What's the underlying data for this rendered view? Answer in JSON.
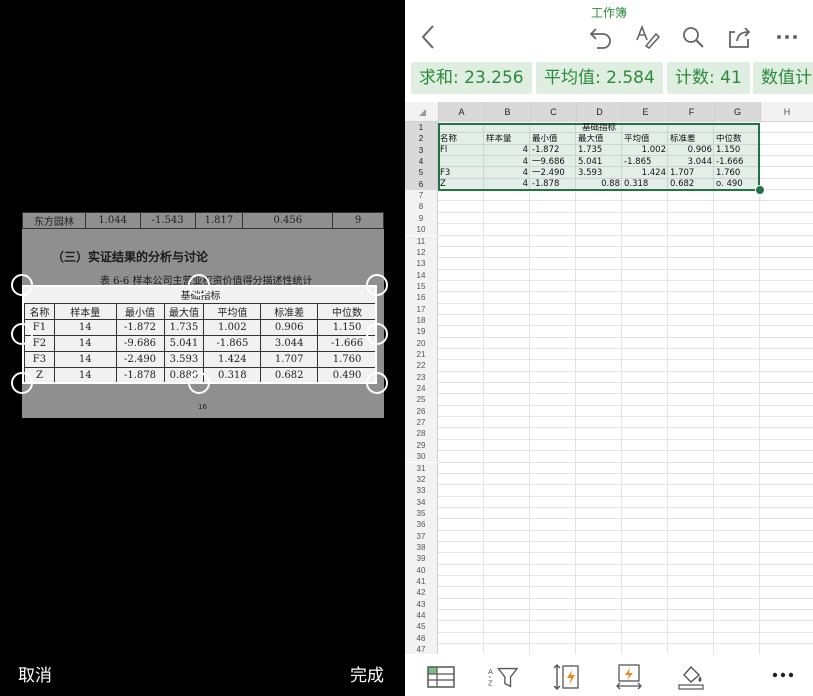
{
  "crop_panel": {
    "cancel_label": "取消",
    "done_label": "完成",
    "photo": {
      "top_rows": [
        [
          "东方园林",
          "1.044",
          "-1.543",
          "1.817",
          "0.456",
          "9"
        ]
      ],
      "heading": "（三）实证结果的分析与讨论",
      "caption": "表 6-6 样本公司主营业权资价值得分描述性统计",
      "table_group_label": "基础指标",
      "table_header": [
        "名称",
        "样本量",
        "最小值",
        "最大值",
        "平均值",
        "标准差",
        "中位数"
      ],
      "table_rows": [
        [
          "F1",
          "14",
          "-1.872",
          "1.735",
          "1.002",
          "0.906",
          "1.150"
        ],
        [
          "F2",
          "14",
          "-9.686",
          "5.041",
          "-1.865",
          "3.044",
          "-1.666"
        ],
        [
          "F3",
          "14",
          "-2.490",
          "3.593",
          "1.424",
          "1.707",
          "1.760"
        ],
        [
          "Z",
          "14",
          "-1.878",
          "0.880",
          "0.318",
          "0.682",
          "0.490"
        ]
      ],
      "page_number": "16"
    }
  },
  "excel": {
    "workbook_title": "工作簿",
    "toolbar_icons": [
      "back-icon",
      "undo-icon",
      "format-text-icon",
      "search-icon",
      "share-icon",
      "more-icon"
    ],
    "stats": {
      "sum": "求和: 23.256",
      "average": "平均值: 2.584",
      "count": "计数: 41",
      "numeric_count": "数值计"
    },
    "columns": [
      "A",
      "B",
      "C",
      "D",
      "E",
      "F",
      "G",
      "H"
    ],
    "rows": [
      "1",
      "2",
      "3",
      "4",
      "5",
      "6",
      "7",
      "8",
      "9",
      "10",
      "11",
      "12",
      "13",
      "14",
      "15",
      "16",
      "17",
      "18",
      "19",
      "20",
      "21",
      "22",
      "23",
      "24",
      "25",
      "26",
      "27",
      "28",
      "29",
      "30",
      "31",
      "32",
      "33",
      "34",
      "35",
      "36",
      "37",
      "38",
      "39",
      "40",
      "41",
      "42",
      "43",
      "44",
      "45",
      "46",
      "47"
    ],
    "cells": {
      "d1": "基础指标",
      "header": [
        "名称",
        "样本量",
        "最小值",
        "最大值",
        "平均值",
        "标准差",
        "中位数"
      ],
      "data": [
        [
          "Fl",
          "4",
          "-1.872",
          "1.735",
          "1.002",
          "0.906",
          "1.150"
        ],
        [
          "",
          "4",
          "一9.686",
          "5.041",
          "-1.865",
          "3.044",
          "-1.666"
        ],
        [
          "F3",
          "4",
          "一2.490",
          "3.593",
          "1.424",
          "1.707",
          "1.760"
        ],
        [
          "Z",
          "4",
          "-1.878",
          "0.88",
          "0.318",
          "0.682",
          "o.   490"
        ]
      ]
    },
    "bottom_icons": [
      "table-icon",
      "sort-filter-icon",
      "flash-fill-icon",
      "autofit-icon",
      "fill-color-icon",
      "more-horizontal-icon"
    ]
  }
}
